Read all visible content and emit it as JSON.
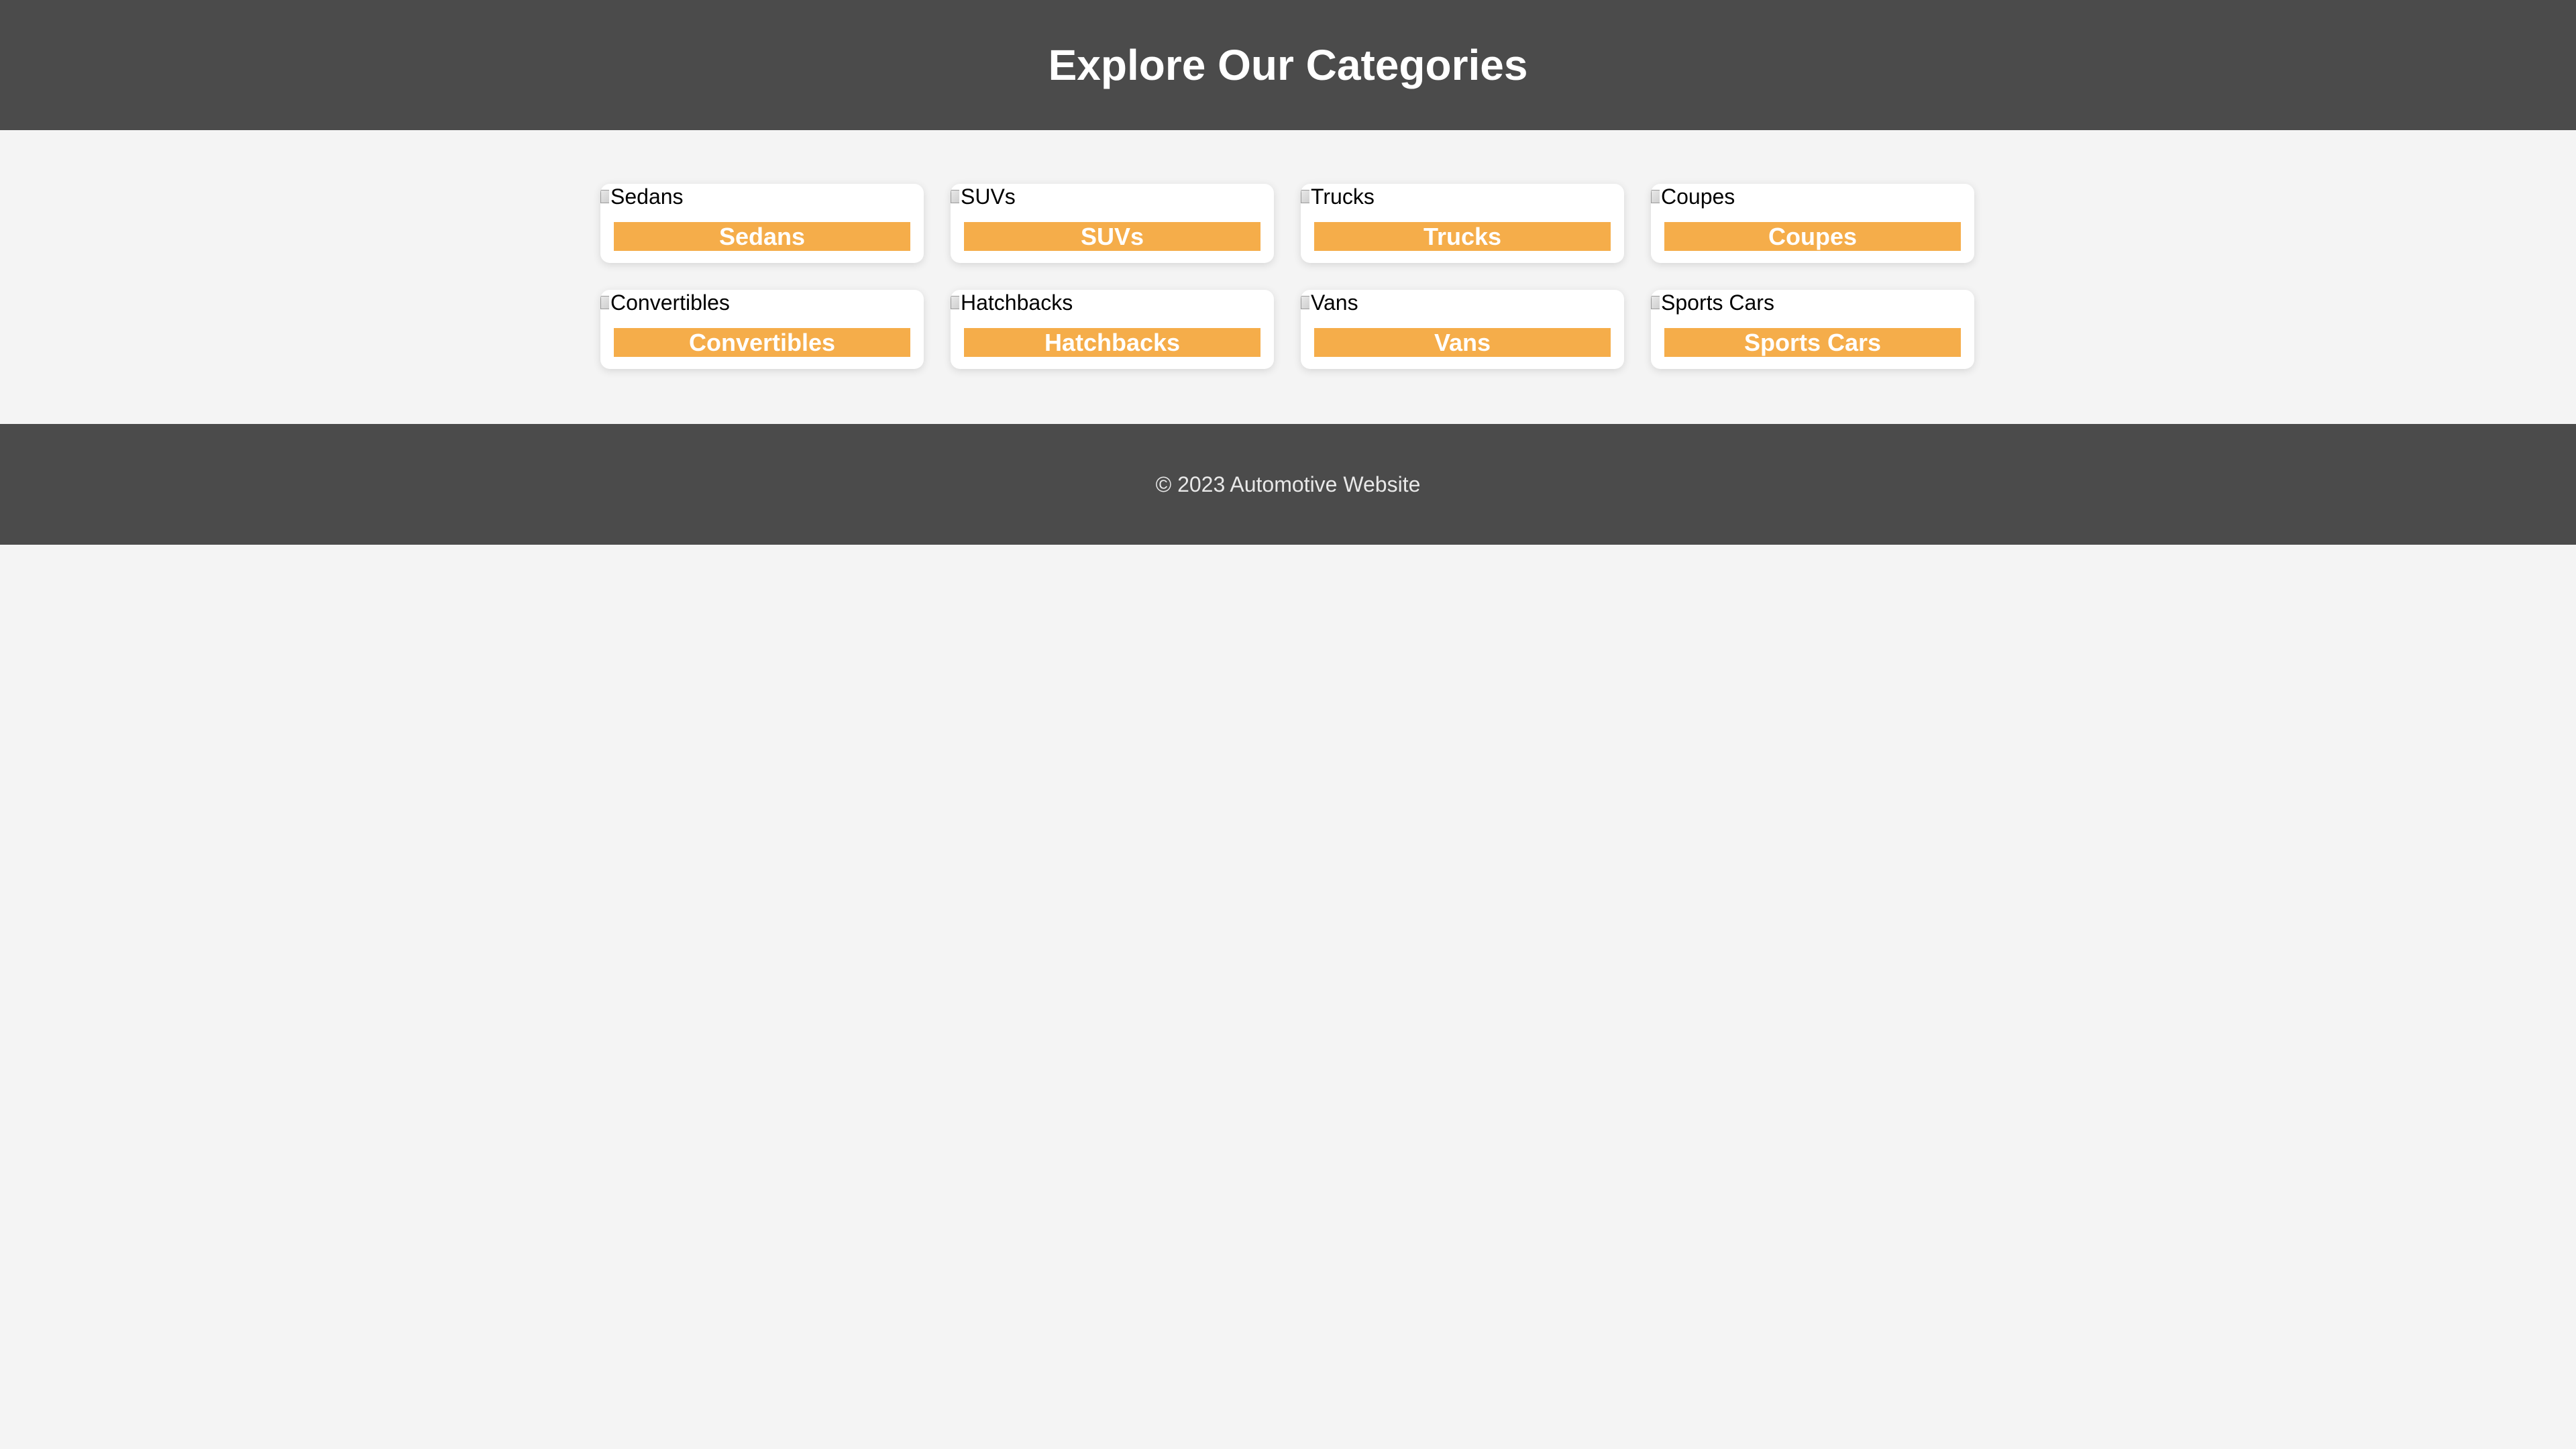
{
  "header": {
    "title": "Explore Our Categories"
  },
  "categories": [
    {
      "image_alt": "Sedans",
      "label": "Sedans"
    },
    {
      "image_alt": "SUVs",
      "label": "SUVs"
    },
    {
      "image_alt": "Trucks",
      "label": "Trucks"
    },
    {
      "image_alt": "Coupes",
      "label": "Coupes"
    },
    {
      "image_alt": "Convertibles",
      "label": "Convertibles"
    },
    {
      "image_alt": "Hatchbacks",
      "label": "Hatchbacks"
    },
    {
      "image_alt": "Vans",
      "label": "Vans"
    },
    {
      "image_alt": "Sports Cars",
      "label": "Sports Cars"
    }
  ],
  "footer": {
    "copyright": "© 2023 Automotive Website"
  },
  "colors": {
    "header_bg": "#4b4b4b",
    "page_bg": "#f4f4f4",
    "accent": "#f5ad4a",
    "card_bg": "#ffffff"
  }
}
